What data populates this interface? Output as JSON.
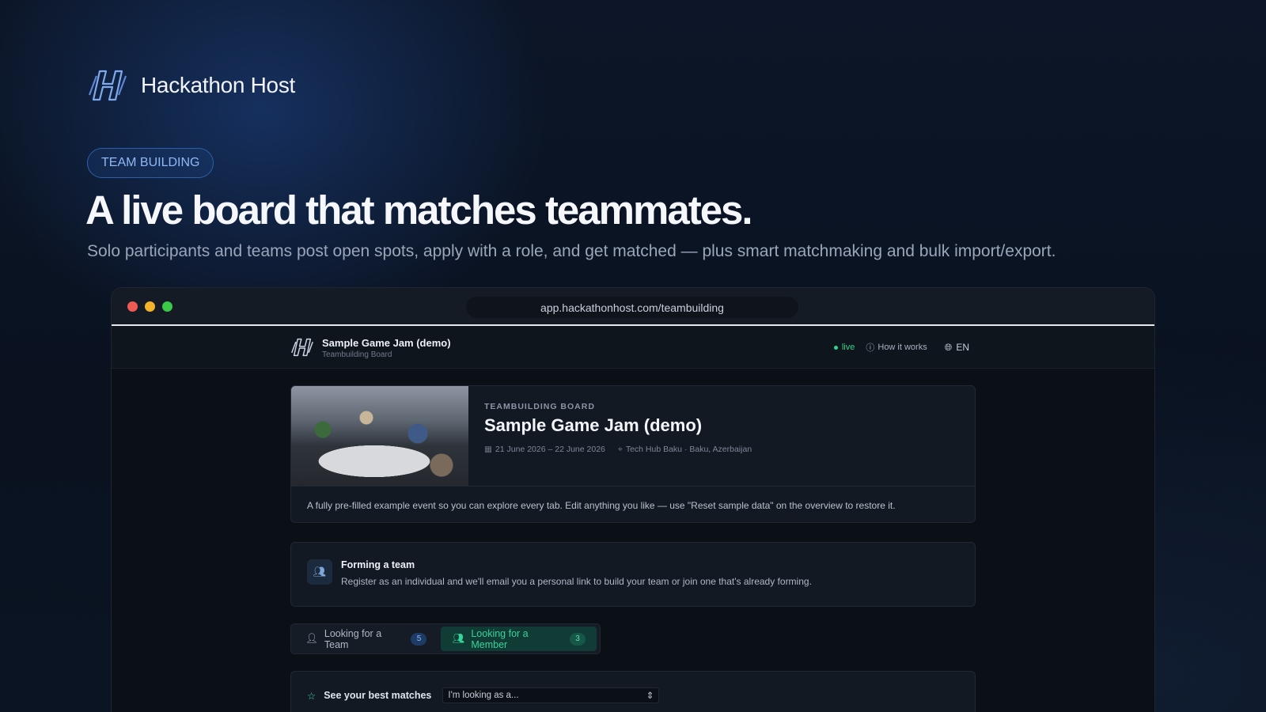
{
  "hero": {
    "brand_name": "Hackathon Host",
    "pill": "TEAM BUILDING",
    "headline": "A live board that matches teammates.",
    "subline": "Solo participants and teams post open spots, apply with a role, and get matched — plus smart matchmaking and bulk import/export."
  },
  "browser": {
    "url": "app.hackathonhost.com/teambuilding"
  },
  "app_header": {
    "title": "Sample Game Jam (demo)",
    "subtitle": "Teambuilding Board",
    "live": "live",
    "how_it_works": "How it works",
    "language": "EN"
  },
  "event": {
    "kicker": "TEAMBUILDING BOARD",
    "title": "Sample Game Jam (demo)",
    "dates": "21 June 2026 – 22 June 2026",
    "location": "Tech Hub Baku · Baku, Azerbaijan",
    "description": "A fully pre-filled example event so you can explore every tab. Edit anything you like — use \"Reset sample data\" on the overview to restore it."
  },
  "forming": {
    "title": "Forming a team",
    "text": "Register as an individual and we'll email you a personal link to build your team or join one that's already forming."
  },
  "tabs": [
    {
      "label": "Looking for a Team",
      "count": "5",
      "active": false
    },
    {
      "label": "Looking for a Member",
      "count": "3",
      "active": true
    }
  ],
  "matches": {
    "label": "See your best matches",
    "select_value": "I'm looking as a..."
  },
  "colors": {
    "accent_green": "#38d39a",
    "accent_blue": "#8fb8f5"
  }
}
